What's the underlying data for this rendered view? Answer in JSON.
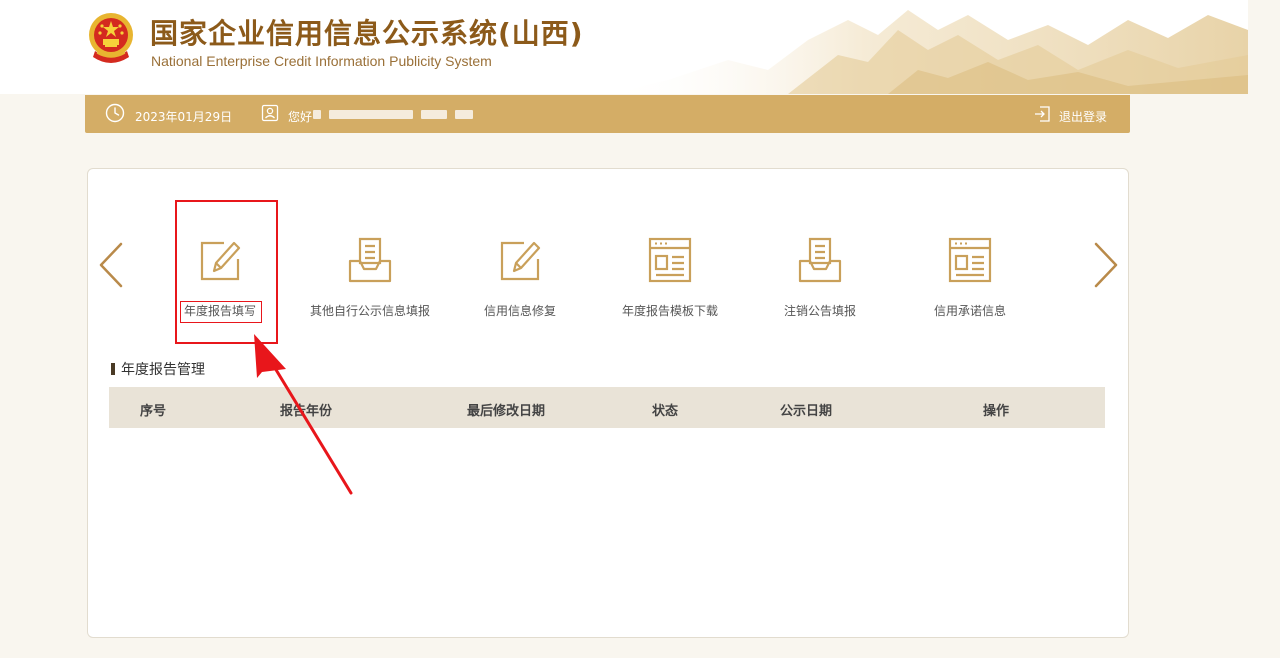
{
  "header": {
    "title": "国家企业信用信息公示系统(山西)",
    "subtitle": "National Enterprise Credit Information Publicity System",
    "emblem_icon": "national-emblem-icon"
  },
  "topbar": {
    "date": "2023年01月29日",
    "greeting": "您好",
    "logout_label": "退出登录",
    "color": "#d4ad66"
  },
  "carousel": {
    "items": [
      {
        "label": "年度报告填写",
        "icon": "edit-icon",
        "selected": true
      },
      {
        "label": "其他自行公示信息填报",
        "icon": "inbox-document-icon"
      },
      {
        "label": "信用信息修复",
        "icon": "edit-icon"
      },
      {
        "label": "年度报告模板下载",
        "icon": "template-window-icon"
      },
      {
        "label": "注销公告填报",
        "icon": "inbox-document-icon"
      },
      {
        "label": "信用承诺信息",
        "icon": "template-window-icon"
      }
    ]
  },
  "section": {
    "title": "年度报告管理"
  },
  "table": {
    "columns": [
      "序号",
      "报告年份",
      "最后修改日期",
      "状态",
      "公示日期",
      "操作"
    ],
    "rows": []
  },
  "accent": {
    "gold": "#c9a05a",
    "highlight_red": "#e8161b"
  }
}
